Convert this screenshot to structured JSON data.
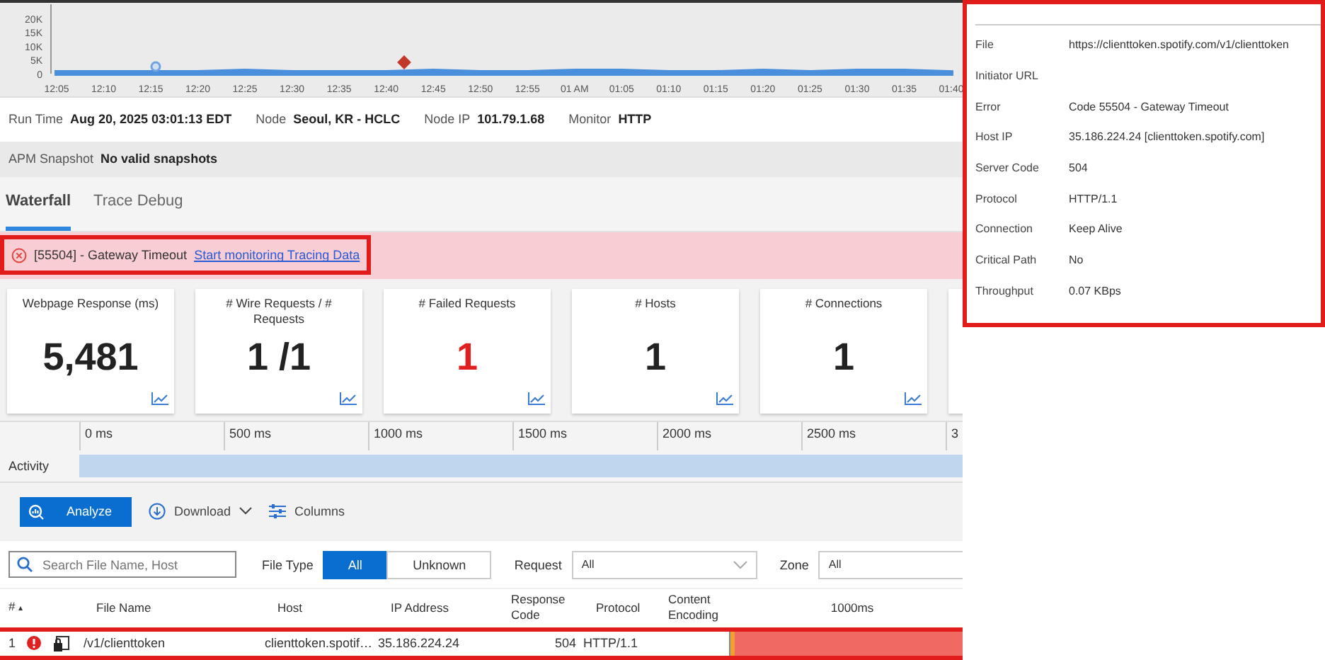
{
  "chart": {
    "chart_data": {
      "type": "area",
      "categories": [
        "12:05",
        "12:10",
        "12:15",
        "12:20",
        "12:25",
        "12:30",
        "12:35",
        "12:40",
        "12:45",
        "12:50",
        "12:55",
        "01 AM",
        "01:05",
        "01:10",
        "01:15",
        "01:20",
        "01:25",
        "01:30",
        "01:35",
        "01:40"
      ],
      "yticks": [
        {
          "value": 0,
          "label": "0"
        },
        {
          "value": 5000,
          "label": "5K"
        },
        {
          "value": 10000,
          "label": "10K"
        },
        {
          "value": 15000,
          "label": "15K"
        },
        {
          "value": 20000,
          "label": "20K"
        }
      ],
      "ylim": [
        0,
        25000
      ],
      "series": [
        {
          "color": "#4a8fdc",
          "values": [
            500,
            500,
            500,
            500,
            1000,
            500,
            500,
            500,
            1000,
            500,
            500,
            1000,
            1000,
            500,
            500,
            1000,
            500,
            1000,
            1000,
            500
          ]
        }
      ]
    }
  },
  "info": [
    {
      "label": "Run Time",
      "value": "Aug 20, 2025 03:01:13 EDT"
    },
    {
      "label": "Node",
      "value": "Seoul, KR - HCLC"
    },
    {
      "label": "Node IP",
      "value": "101.79.1.68"
    },
    {
      "label": "Monitor",
      "value": "HTTP"
    }
  ],
  "apm": {
    "label": "APM Snapshot",
    "value": "No valid snapshots"
  },
  "tabs": [
    {
      "label": "Waterfall",
      "selected": true
    },
    {
      "label": "Trace Debug",
      "selected": false
    }
  ],
  "banner": {
    "message": "[55504] - Gateway Timeout",
    "link": "Start monitoring Tracing Data"
  },
  "cards": [
    {
      "title": "Webpage Response (ms)",
      "value": "5,481",
      "error": false
    },
    {
      "title": "# Wire Requests / # Requests",
      "value": "1 /1",
      "error": false
    },
    {
      "title": "# Failed Requests",
      "value": "1",
      "error": true
    },
    {
      "title": "# Hosts",
      "value": "1",
      "error": false
    },
    {
      "title": "# Connections",
      "value": "1",
      "error": false
    }
  ],
  "timeline": {
    "ticks": [
      "0 ms",
      "500 ms",
      "1000 ms",
      "1500 ms",
      "2000 ms",
      "2500 ms",
      "3"
    ],
    "row_label": "Activity"
  },
  "toolbar": {
    "analyze": "Analyze",
    "download": "Download",
    "columns": "Columns"
  },
  "filters": {
    "search_placeholder": "Search File Name, Host",
    "file_type_label": "File Type",
    "file_types": [
      {
        "label": "All",
        "selected": true
      },
      {
        "label": "Unknown",
        "selected": false
      }
    ],
    "request_label": "Request",
    "request_value": "All",
    "zone_label": "Zone",
    "zone_value": "All"
  },
  "table": {
    "sort_indicator": "▴",
    "columns": [
      "#",
      "File Name",
      "Host",
      "IP Address",
      "Response Code",
      "Protocol",
      "Content Encoding",
      "1000ms"
    ],
    "rows": [
      {
        "index": "1",
        "error": true,
        "file": "/v1/clienttoken",
        "host": "clienttoken.spotif…",
        "ip": "35.186.224.24",
        "code": "504",
        "protocol": "HTTP/1.1"
      }
    ]
  },
  "details": [
    {
      "label": "File",
      "value": "https://clienttoken.spotify.com/v1/clienttoken"
    },
    {
      "label": "Initiator URL"
    },
    {
      "label": "Error",
      "value": "Code 55504 - Gateway Timeout"
    },
    {
      "label": "Host IP",
      "value": "35.186.224.24 [clienttoken.spotify.com]"
    },
    {
      "label": "Server Code",
      "value": "504"
    },
    {
      "label": "Protocol",
      "value": "HTTP/1.1"
    },
    {
      "label": "Connection",
      "value": "Keep Alive"
    },
    {
      "label": "Critical Path",
      "value": "No"
    },
    {
      "label": "Throughput",
      "value": "0.07 KBps"
    }
  ]
}
